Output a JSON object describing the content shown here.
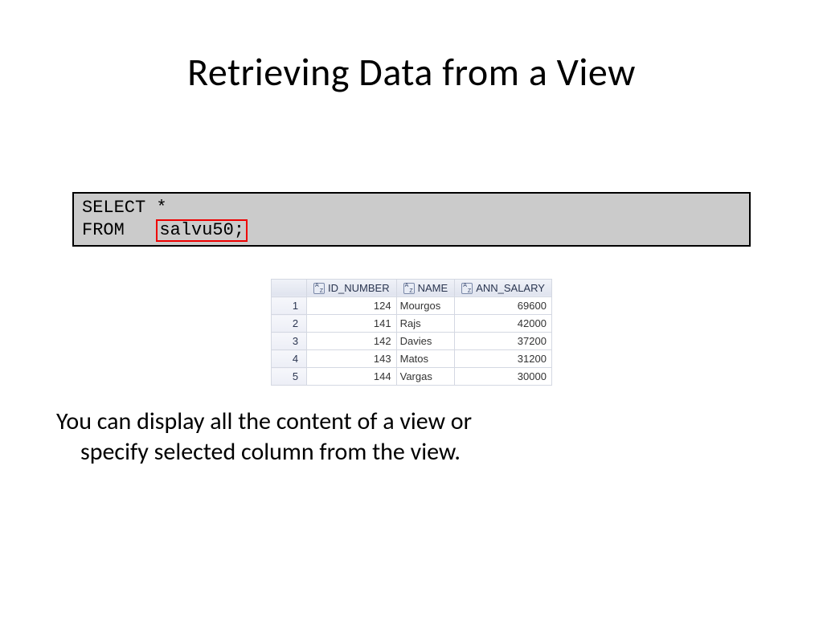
{
  "title": "Retrieving Data from a View",
  "sql": {
    "line1_kw": "SELECT",
    "line1_rest": " *",
    "line2_kw": "FROM",
    "line2_gap": "   ",
    "highlighted": "salvu50;"
  },
  "chart_data": {
    "type": "table",
    "columns": [
      "ID_NUMBER",
      "NAME",
      "ANN_SALARY"
    ],
    "rows": [
      {
        "n": "1",
        "id": "124",
        "name": "Mourgos",
        "sal": "69600"
      },
      {
        "n": "2",
        "id": "141",
        "name": "Rajs",
        "sal": "42000"
      },
      {
        "n": "3",
        "id": "142",
        "name": "Davies",
        "sal": "37200"
      },
      {
        "n": "4",
        "id": "143",
        "name": "Matos",
        "sal": "31200"
      },
      {
        "n": "5",
        "id": "144",
        "name": "Vargas",
        "sal": "30000"
      }
    ]
  },
  "body": {
    "line1": "You can display all the content of a view or",
    "line2": "specify selected column from the view."
  }
}
